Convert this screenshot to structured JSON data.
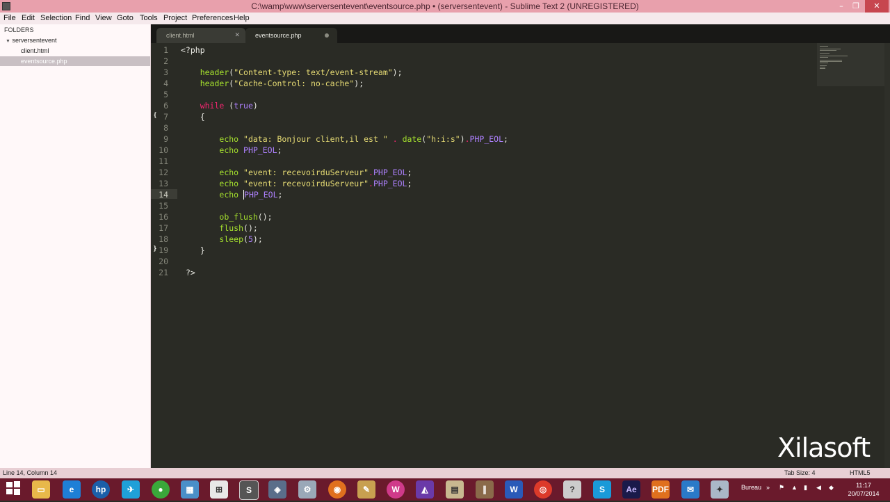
{
  "window": {
    "title": "C:\\wamp\\www\\serversentevent\\eventsource.php • (serversentevent) - Sublime Text 2 (UNREGISTERED)",
    "controls": [
      "–",
      "❐",
      "✕"
    ]
  },
  "menu": [
    "File",
    "Edit",
    "Selection",
    "Find",
    "View",
    "Goto",
    "Tools",
    "Project",
    "Preferences",
    "Help"
  ],
  "sidebar": {
    "header": "FOLDERS",
    "folder": "serversentevent",
    "files": [
      "client.html",
      "eventsource.php"
    ]
  },
  "tabs": [
    {
      "label": "client.html"
    },
    {
      "label": "eventsource.php"
    }
  ],
  "editor": {
    "line_numbers": [
      "1",
      "2",
      "3",
      "4",
      "5",
      "6",
      "7",
      "8",
      "9",
      "10",
      "11",
      "12",
      "13",
      "14",
      "15",
      "16",
      "17",
      "18",
      "19",
      "20",
      "21"
    ],
    "current_line": "14",
    "code": {
      "l1": "<?php",
      "l3_fn": "header",
      "l3_str": "\"Content-type: text/event-stream\"",
      "l4_fn": "header",
      "l4_str": "\"Cache-Control: no-cache\"",
      "l6_kw": "while",
      "l6_const": "true",
      "l7": "{",
      "l9_echo": "echo",
      "l9_str": "\"data: Bonjour client,il est \"",
      "l9_fn": "date",
      "l9_arg": "\"h:i:s\"",
      "l9_const": "PHP_EOL",
      "l10_echo": "echo",
      "l10_const": "PHP_EOL",
      "l12_echo": "echo",
      "l12_str": "\"event: recevoirduServeur\"",
      "l12_const": "PHP_EOL",
      "l13_echo": "echo",
      "l13_str": "\"event: recevoirduServeur\"",
      "l13_const": "PHP_EOL",
      "l14_echo": "echo",
      "l14_const": "PHP_EOL",
      "l16_fn": "ob_flush",
      "l17_fn": "flush",
      "l18_fn": "sleep",
      "l18_num": "5",
      "l19": "}",
      "l21": "?>"
    }
  },
  "watermark": "Xilasoft",
  "status": {
    "position": "Line 14, Column 14",
    "tab_size": "Tab Size: 4",
    "syntax": "HTML5"
  },
  "taskbar": {
    "tray_label": "Bureau",
    "time": "11:17",
    "date": "20/07/2014",
    "apps": [
      "start-icon",
      "file-explorer-icon",
      "internet-explorer-icon",
      "hp-icon",
      "sharepoint-icon",
      "green-app-icon",
      "network-icon",
      "apps-grid-icon",
      "sublime-text-icon",
      "virtualbox-icon",
      "settings-icon",
      "firefox-icon",
      "tools-icon",
      "wamp-icon",
      "visual-studio-icon",
      "files-icon",
      "library-icon",
      "word-icon",
      "chrome-icon",
      "help-icon",
      "skype-icon",
      "after-effects-icon",
      "pdf-icon",
      "thunderbird-icon",
      "control-panel-icon"
    ]
  },
  "colors": {
    "background": "#2a2b25",
    "keyword": "#f92672",
    "function": "#a6e22e",
    "string": "#e6db74",
    "constant": "#ae81ff",
    "text": "#e8e8e2",
    "taskbar": "#6a1a2c",
    "titlebar": "#e8a0ac"
  }
}
